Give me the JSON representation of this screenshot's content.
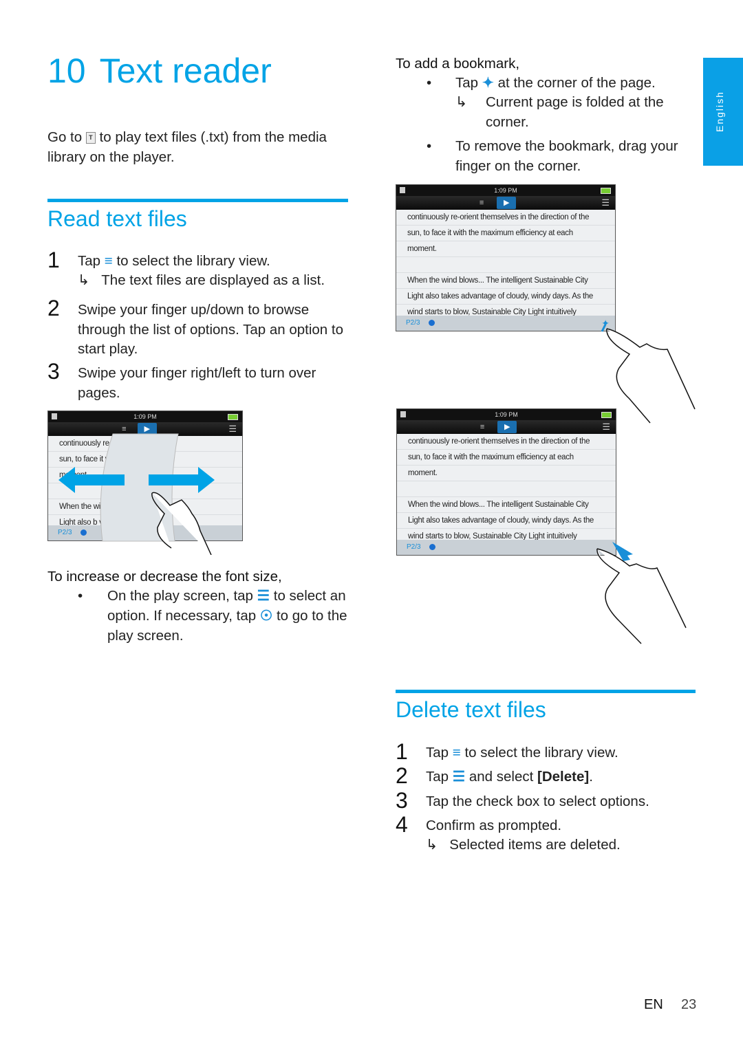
{
  "title": {
    "number": "10",
    "text": "Text reader"
  },
  "intro": {
    "before": "Go to",
    "after": "to play text files (.txt) from the media library on the player.",
    "icon": "text-reader-icon"
  },
  "read_section": {
    "heading": "Read text files",
    "steps": [
      {
        "num": "1",
        "before": "Tap",
        "icon": "library-view-icon",
        "after": "to select the library view.",
        "result": "The text files are displayed as a list."
      },
      {
        "num": "2",
        "text": "Swipe your finger up/down to browse through the list of options. Tap an option to start play."
      },
      {
        "num": "3",
        "text": "Swipe your finger right/left to turn over pages."
      }
    ]
  },
  "font_section": {
    "heading": "To increase or decrease the font size,",
    "bullet": {
      "p1": "On the play screen, tap",
      "p2": "to select an option. If necessary, tap",
      "p3": "to go to the play screen."
    }
  },
  "bookmark_section": {
    "heading": "To add a bookmark,",
    "bullets": [
      {
        "before": "Tap",
        "after": "at the corner of the page.",
        "result": "Current page is folded at the corner."
      },
      {
        "text": "To remove the bookmark, drag your finger on the corner."
      }
    ]
  },
  "delete_section": {
    "heading": "Delete text files",
    "steps": [
      {
        "num": "1",
        "before": "Tap",
        "after": "to select the library view."
      },
      {
        "num": "2",
        "before": "Tap",
        "after": "and select",
        "bold": "[Delete]",
        "end": "."
      },
      {
        "num": "3",
        "text": "Tap the check box to select options."
      },
      {
        "num": "4",
        "text": "Confirm as prompted.",
        "result": "Selected items are deleted."
      }
    ]
  },
  "device": {
    "time": "1:09 PM",
    "page": "P2/3",
    "lines": [
      "continuously re-orient themselves in the direction of the",
      "sun, to face it with the maximum efficiency at each",
      "moment.",
      "",
      "When the wind blows... The intelligent Sustainable City",
      "Light also takes advantage of cloudy, windy days. As the",
      "wind starts to blow, Sustainable City Light intuitively"
    ],
    "partial_lines": [
      "continuously re          he direction of the",
      "sun, to face it v          iency at each",
      "moment.",
      "",
      "When the wi          nt Sustainable City",
      "Light also b          y days. As the",
      "wind start          itively"
    ]
  },
  "side_tab": "English",
  "footer": {
    "lang": "EN",
    "page": "23"
  },
  "colors": {
    "accent": "#00a3e6",
    "text": "#222222"
  }
}
